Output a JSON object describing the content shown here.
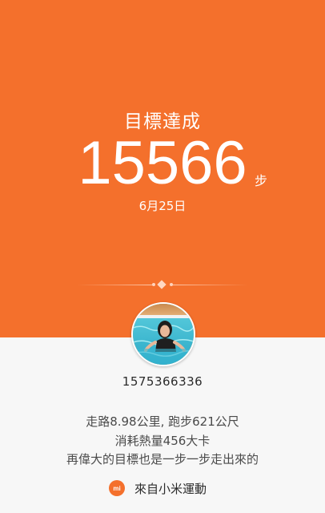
{
  "goal": {
    "title": "目標達成",
    "steps": "15566",
    "steps_unit": "步",
    "date": "6月25日"
  },
  "profile": {
    "user_id": "1575366336",
    "avatar_icon": "user-photo"
  },
  "summary": {
    "line1": "走路8.98公里, 跑步621公尺",
    "line2": "消耗熱量456大卡",
    "line3": "再偉大的目標也是一步一步走出來的"
  },
  "footer": {
    "app_icon": "mi-logo",
    "app_icon_text": "mi",
    "label": "來自小米運動"
  },
  "colors": {
    "accent": "#f4702c",
    "background": "#f7f7f7",
    "text_primary": "#2b2b2b",
    "text_secondary": "#4a4a4a"
  }
}
